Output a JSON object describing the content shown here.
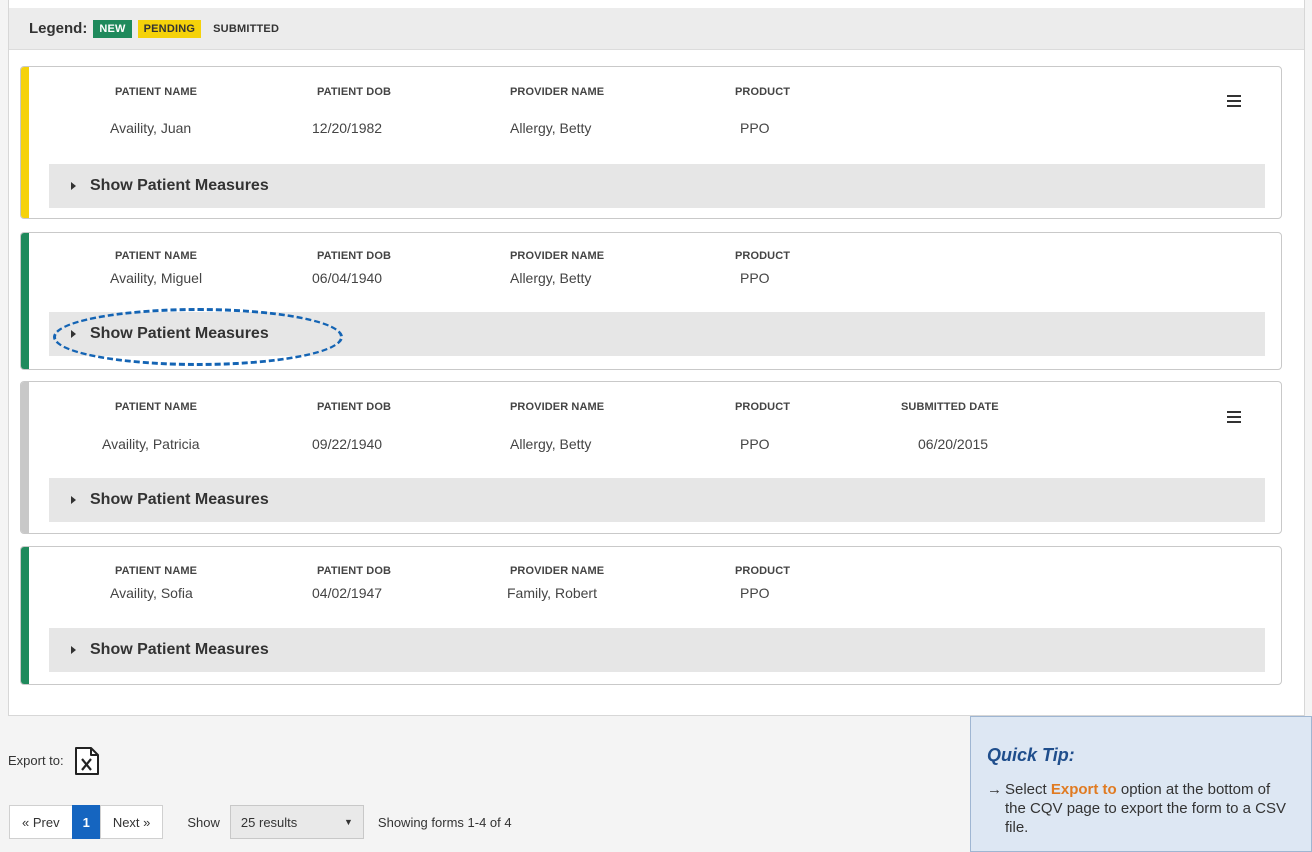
{
  "legend": {
    "label": "Legend:",
    "new": "NEW",
    "pending": "PENDING",
    "submitted": "SUBMITTED"
  },
  "colors": {
    "new": "#1f8a5c",
    "pending": "#f5d20a",
    "submitted": "#c8c8c8",
    "accent": "#1565c0"
  },
  "headers": {
    "patient_name": "PATIENT NAME",
    "patient_dob": "PATIENT DOB",
    "provider_name": "PROVIDER NAME",
    "product": "PRODUCT",
    "submitted_date": "SUBMITTED DATE"
  },
  "cards": [
    {
      "status": "pending",
      "patient_name": "Availity, Juan",
      "patient_dob": "12/20/1982",
      "provider_name": "Allergy, Betty",
      "product": "PPO",
      "measures_label": "Show Patient Measures"
    },
    {
      "status": "new",
      "patient_name": "Availity, Miguel",
      "patient_dob": "06/04/1940",
      "provider_name": "Allergy, Betty",
      "product": "PPO",
      "measures_label": "Show Patient Measures"
    },
    {
      "status": "submitted",
      "patient_name": "Availity, Patricia",
      "patient_dob": "09/22/1940",
      "provider_name": "Allergy, Betty",
      "product": "PPO",
      "submitted_date": "06/20/2015",
      "measures_label": "Show Patient Measures"
    },
    {
      "status": "new",
      "patient_name": "Availity, Sofia",
      "patient_dob": "04/02/1947",
      "provider_name": "Family, Robert",
      "product": "PPO",
      "measures_label": "Show Patient Measures"
    }
  ],
  "export": {
    "label": "Export to:",
    "icon": "excel-file-icon"
  },
  "pagination": {
    "prev": "« Prev",
    "page": "1",
    "next": "Next »",
    "show_label": "Show",
    "results_option": "25 results",
    "showing": "Showing forms 1-4 of 4"
  },
  "tip": {
    "title": "Quick Tip:",
    "arrow": "→",
    "text_before": "Select ",
    "text_emphasis": "Export to",
    "text_after": " option at the bottom of the CQV page to export the form to a CSV file."
  }
}
